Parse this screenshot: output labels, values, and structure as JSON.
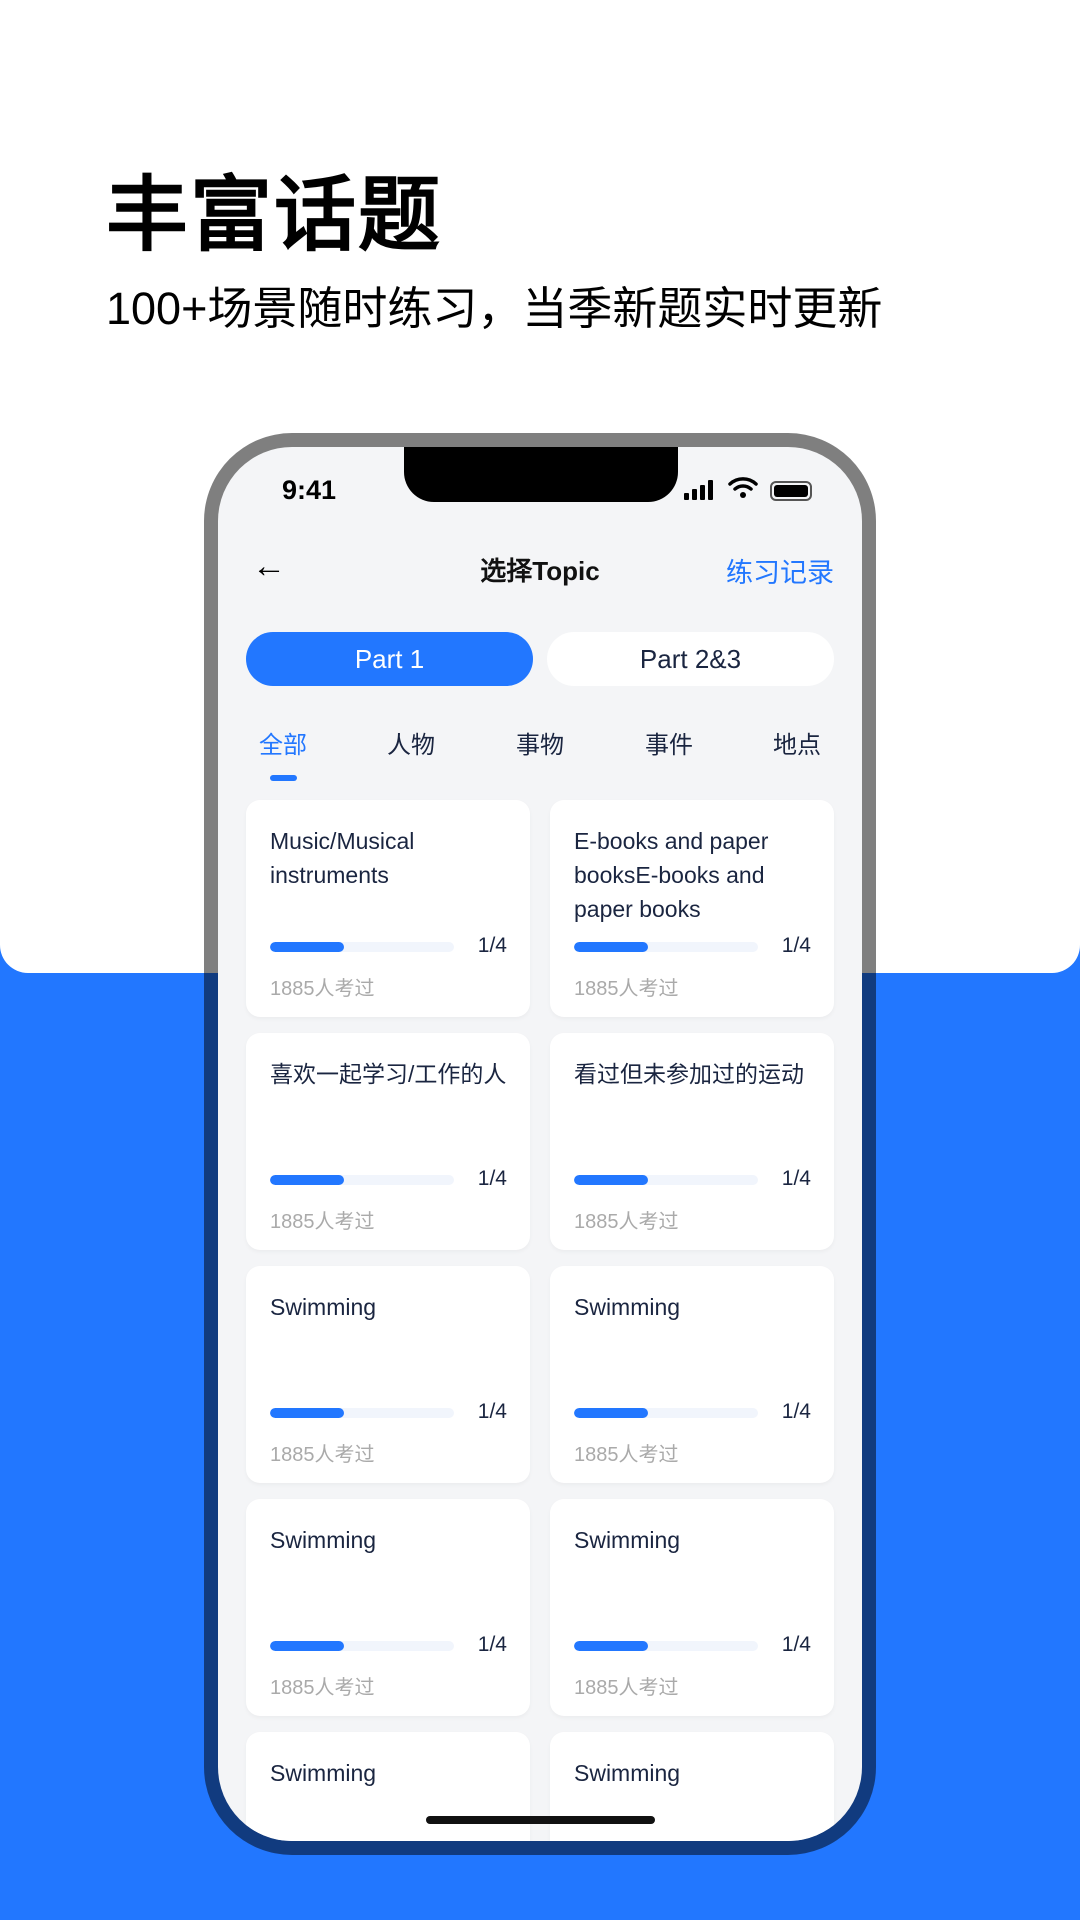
{
  "promo": {
    "headline": "丰富话题",
    "subtitle": "100+场景随时练习，当季新题实时更新"
  },
  "status_bar": {
    "time": "9:41"
  },
  "nav": {
    "title": "选择Topic",
    "right_link": "练习记录",
    "back_icon": "arrow-left-icon"
  },
  "segments": [
    {
      "label": "Part 1",
      "active": true
    },
    {
      "label": "Part 2&3",
      "active": false
    }
  ],
  "categories": [
    {
      "label": "全部",
      "active": true
    },
    {
      "label": "人物"
    },
    {
      "label": "事物"
    },
    {
      "label": "事件"
    },
    {
      "label": "地点"
    }
  ],
  "cards": [
    {
      "title": "Music/Musical instruments",
      "progress_fill": 0.4,
      "progress_text": "1/4",
      "taken": "1885人考过"
    },
    {
      "title": "E-books and paper booksE-books and paper books",
      "progress_fill": 0.4,
      "progress_text": "1/4",
      "taken": "1885人考过"
    },
    {
      "title": "喜欢一起学习/工作的人",
      "progress_fill": 0.4,
      "progress_text": "1/4",
      "taken": "1885人考过"
    },
    {
      "title": "看过但未参加过的运动",
      "progress_fill": 0.4,
      "progress_text": "1/4",
      "taken": "1885人考过"
    },
    {
      "title": "Swimming",
      "progress_fill": 0.4,
      "progress_text": "1/4",
      "taken": "1885人考过"
    },
    {
      "title": "Swimming",
      "progress_fill": 0.4,
      "progress_text": "1/4",
      "taken": "1885人考过"
    },
    {
      "title": "Swimming",
      "progress_fill": 0.4,
      "progress_text": "1/4",
      "taken": "1885人考过"
    },
    {
      "title": "Swimming",
      "progress_fill": 0.4,
      "progress_text": "1/4",
      "taken": "1885人考过"
    },
    {
      "title": "Swimming"
    },
    {
      "title": "Swimming"
    }
  ],
  "colors": {
    "accent": "#2277ff",
    "text": "#1a2540",
    "muted": "#aaaaaa",
    "screen_bg": "#f4f5f7"
  }
}
